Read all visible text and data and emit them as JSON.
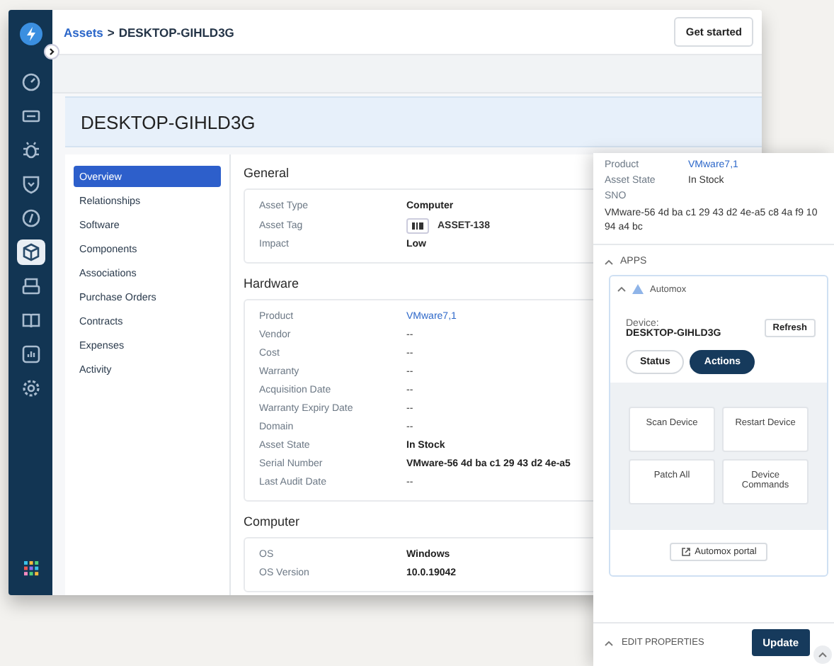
{
  "rail": [
    {
      "kind": "logo",
      "selected": false
    },
    {
      "kind": "gauge",
      "selected": false
    },
    {
      "kind": "ticket",
      "selected": false
    },
    {
      "kind": "bug",
      "selected": false
    },
    {
      "kind": "shield",
      "selected": false
    },
    {
      "kind": "coin",
      "selected": false
    },
    {
      "kind": "cube",
      "selected": true
    },
    {
      "kind": "tray",
      "selected": false
    },
    {
      "kind": "book",
      "selected": false
    },
    {
      "kind": "chart",
      "selected": false
    },
    {
      "kind": "gear",
      "selected": false
    },
    {
      "kind": "grid",
      "selected": false
    }
  ],
  "breadcrumb": {
    "parent": "Assets",
    "separator": ">",
    "current": "DESKTOP-GIHLD3G"
  },
  "header_button": "Get started",
  "page_title": "DESKTOP-GIHLD3G",
  "nav": [
    {
      "label": "Overview",
      "selected": true
    },
    {
      "label": "Relationships",
      "selected": false
    },
    {
      "label": "Software",
      "selected": false
    },
    {
      "label": "Components",
      "selected": false
    },
    {
      "label": "Associations",
      "selected": false
    },
    {
      "label": "Purchase Orders",
      "selected": false
    },
    {
      "label": "Contracts",
      "selected": false
    },
    {
      "label": "Expenses",
      "selected": false
    },
    {
      "label": "Activity",
      "selected": false
    }
  ],
  "sections": [
    {
      "title": "General",
      "rows": [
        {
          "label": "Asset Type",
          "value": "Computer",
          "kind": "bold"
        },
        {
          "label": "Asset Tag",
          "value": "ASSET-138",
          "kind": "tag"
        },
        {
          "label": "Impact",
          "value": "Low",
          "kind": "bold"
        }
      ]
    },
    {
      "title": "Hardware",
      "rows": [
        {
          "label": "Product",
          "value": "VMware7,1",
          "kind": "link"
        },
        {
          "label": "Vendor",
          "value": "--",
          "kind": "plain"
        },
        {
          "label": "Cost",
          "value": "--",
          "kind": "plain"
        },
        {
          "label": "Warranty",
          "value": "--",
          "kind": "plain"
        },
        {
          "label": "Acquisition Date",
          "value": "--",
          "kind": "plain"
        },
        {
          "label": "Warranty Expiry Date",
          "value": "--",
          "kind": "plain"
        },
        {
          "label": "Domain",
          "value": "--",
          "kind": "plain"
        },
        {
          "label": "Asset State",
          "value": "In Stock",
          "kind": "bold"
        },
        {
          "label": "Serial Number",
          "value": "VMware-56 4d ba c1 29 43 d2 4e-a5",
          "kind": "bold"
        },
        {
          "label": "Last Audit Date",
          "value": "--",
          "kind": "plain"
        }
      ]
    },
    {
      "title": "Computer",
      "rows": [
        {
          "label": "OS",
          "value": "Windows",
          "kind": "bold"
        },
        {
          "label": "OS Version",
          "value": "10.0.19042",
          "kind": "bold"
        }
      ]
    }
  ],
  "panel": {
    "fields": [
      {
        "label": "Product",
        "value": "VMware7,1",
        "kind": "link"
      },
      {
        "label": "Asset State",
        "value": "In Stock",
        "kind": "plain"
      }
    ],
    "sno_label": "SNO",
    "sno_value": "VMware-56 4d ba c1 29 43 d2 4e-a5 c8 4a f9 10 94 a4 bc",
    "apps_title": "APPS",
    "app": {
      "name": "Automox",
      "device_label": "Device:",
      "device_name": "DESKTOP-GIHLD3G",
      "refresh": "Refresh",
      "tabs": [
        {
          "label": "Status",
          "selected": false
        },
        {
          "label": "Actions",
          "selected": true
        }
      ],
      "actions": [
        "Scan Device",
        "Restart Device",
        "Patch All",
        "Device Commands"
      ],
      "portal": "Automox portal"
    },
    "footer_title": "EDIT PROPERTIES",
    "footer_button": "Update"
  }
}
